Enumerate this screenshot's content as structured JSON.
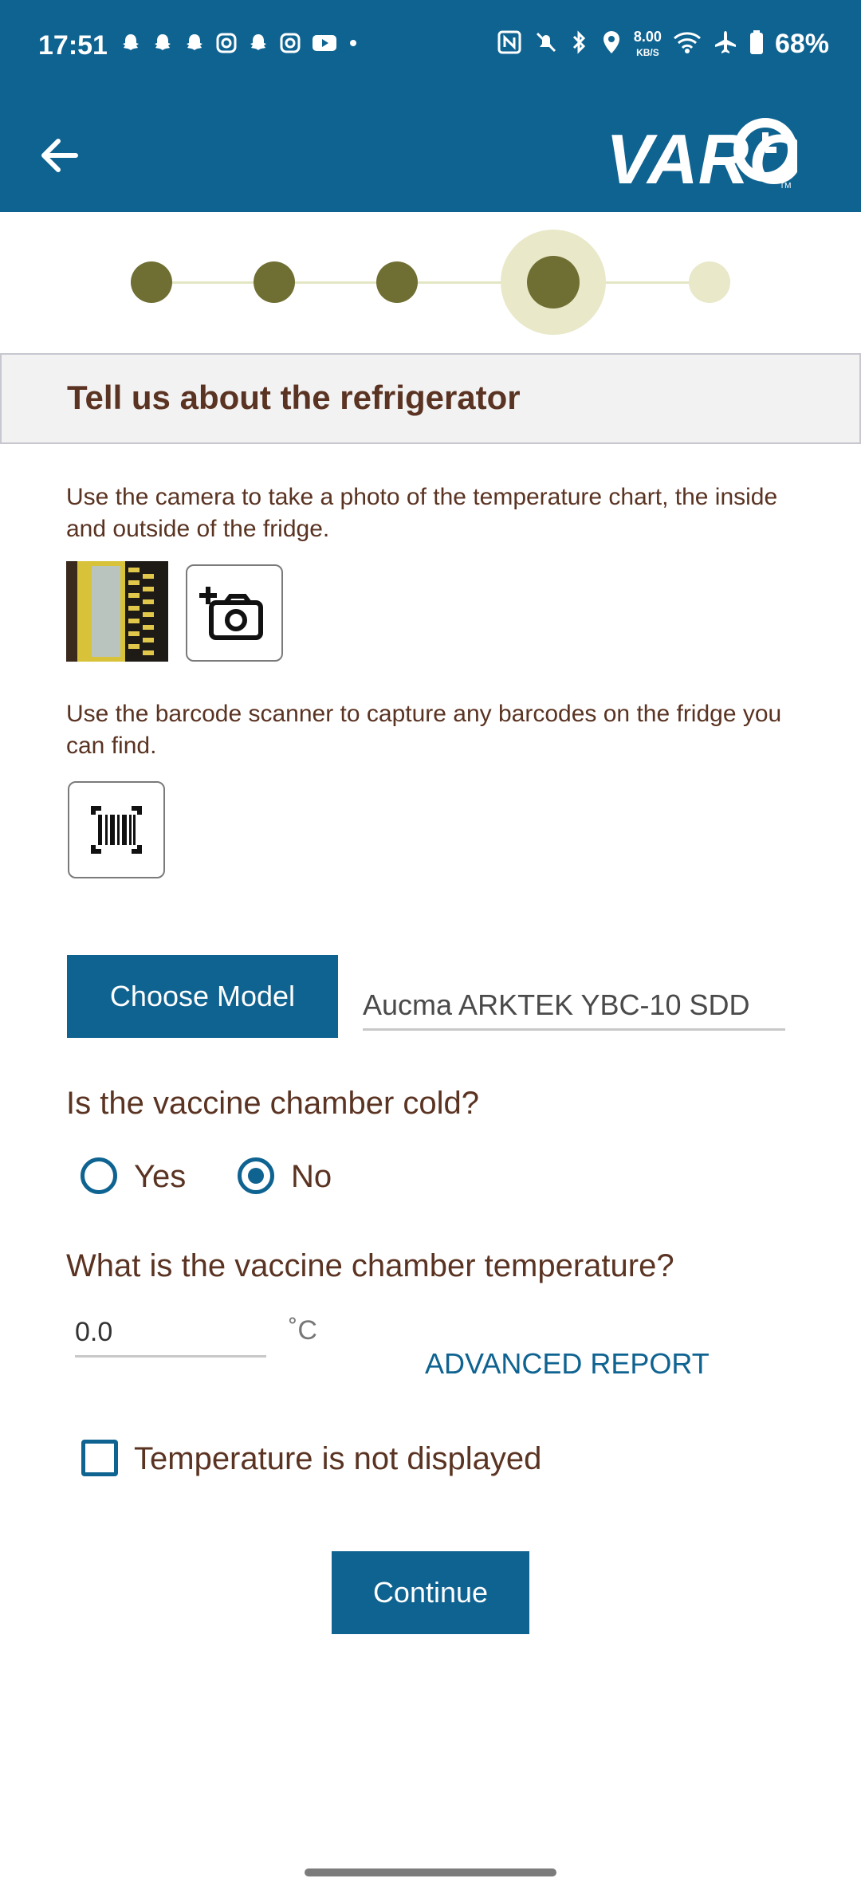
{
  "status_bar": {
    "time": "17:51",
    "net_speed_value": "8.00",
    "net_speed_unit": "KB/S",
    "battery": "68%"
  },
  "header": {
    "back_icon": "arrow-left-icon",
    "logo_text": "VARO",
    "colors": {
      "bar": "#0f6391"
    }
  },
  "stepper": {
    "total_steps": 5,
    "current_step": 4
  },
  "section": {
    "title": "Tell us about the refrigerator"
  },
  "photo": {
    "instructions": "Use the camera to take a photo of the temperature chart, the inside and outside of the fridge.",
    "add_photo_icon": "camera-add-icon"
  },
  "barcode": {
    "instructions": "Use the barcode scanner to capture any barcodes on the fridge you can find.",
    "scan_icon": "barcode-scan-icon"
  },
  "model": {
    "button_label": "Choose Model",
    "value": "Aucma ARKTEK YBC-10 SDD"
  },
  "cold_question": {
    "label": "Is the vaccine chamber cold?",
    "options": [
      {
        "label": "Yes",
        "selected": false
      },
      {
        "label": "No",
        "selected": true
      }
    ]
  },
  "temperature": {
    "label": "What is the vaccine chamber temperature?",
    "value": "0.0",
    "unit": "˚C",
    "advanced_link": "ADVANCED REPORT"
  },
  "not_displayed": {
    "label": "Temperature is not displayed",
    "checked": false
  },
  "continue_button": {
    "label": "Continue"
  }
}
